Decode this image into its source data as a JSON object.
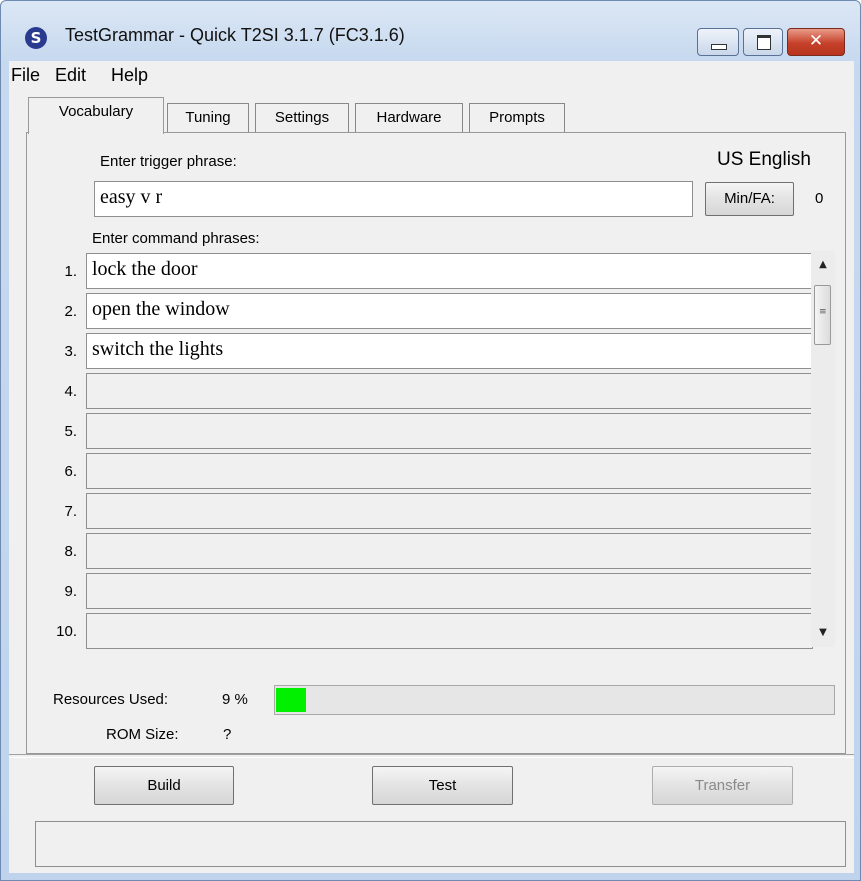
{
  "window": {
    "title": "TestGrammar - Quick T2SI 3.1.7 (FC3.1.6)",
    "app_icon": "S",
    "close_glyph": "✕"
  },
  "menu": [
    "File",
    "Edit",
    "Help"
  ],
  "tabs": [
    {
      "label": "Vocabulary",
      "active": true
    },
    {
      "label": "Tuning",
      "active": false
    },
    {
      "label": "Settings",
      "active": false
    },
    {
      "label": "Hardware",
      "active": false
    },
    {
      "label": "Prompts",
      "active": false
    }
  ],
  "vocabulary": {
    "trigger_label": "Enter trigger phrase:",
    "language": "US English",
    "trigger_value": "easy v r",
    "minfa_label": "Min/FA:",
    "minfa_value": "0",
    "command_label": "Enter command phrases:",
    "commands": [
      {
        "num": "1.",
        "text": "lock the door",
        "enabled": true
      },
      {
        "num": "2.",
        "text": "open the window",
        "enabled": true
      },
      {
        "num": "3.",
        "text": "switch the lights",
        "enabled": true
      },
      {
        "num": "4.",
        "text": "",
        "enabled": false
      },
      {
        "num": "5.",
        "text": "",
        "enabled": false
      },
      {
        "num": "6.",
        "text": "",
        "enabled": false
      },
      {
        "num": "7.",
        "text": "",
        "enabled": false
      },
      {
        "num": "8.",
        "text": "",
        "enabled": false
      },
      {
        "num": "9.",
        "text": "",
        "enabled": false
      },
      {
        "num": "10.",
        "text": "",
        "enabled": false
      }
    ],
    "scroll_up": "▲",
    "scroll_down": "▼",
    "resources_label": "Resources Used:",
    "resources_value": "9 %",
    "resources_fraction": 0.09,
    "rom_label": "ROM Size:",
    "rom_value": "?"
  },
  "buttons": {
    "build": "Build",
    "test": "Test",
    "transfer": "Transfer"
  },
  "status_text": "",
  "colors": {
    "progress": "#00f000",
    "close_button": "#c6412a"
  }
}
